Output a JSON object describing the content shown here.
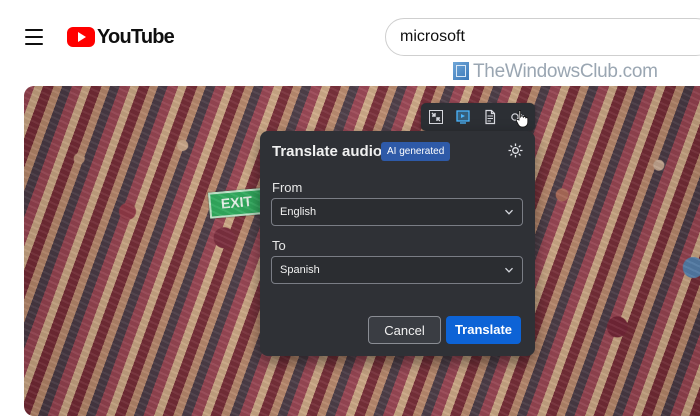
{
  "app": {
    "brand": "YouTube",
    "search_value": "microsoft"
  },
  "watermark": {
    "text": "TheWindowsClub.com"
  },
  "video": {
    "sign_text": "EXIT"
  },
  "toolbar": {
    "icons": [
      "collapse-icon",
      "screen-icon",
      "document-icon",
      "translate-audio-icon"
    ]
  },
  "dialog": {
    "title": "Translate audio",
    "badge": "AI generated",
    "from_label": "From",
    "from_value": "English",
    "to_label": "To",
    "to_value": "Spanish",
    "cancel_label": "Cancel",
    "translate_label": "Translate"
  },
  "colors": {
    "accent": "#0d63d6",
    "badge": "#2e5aa8",
    "youtube_red": "#ff0000"
  }
}
